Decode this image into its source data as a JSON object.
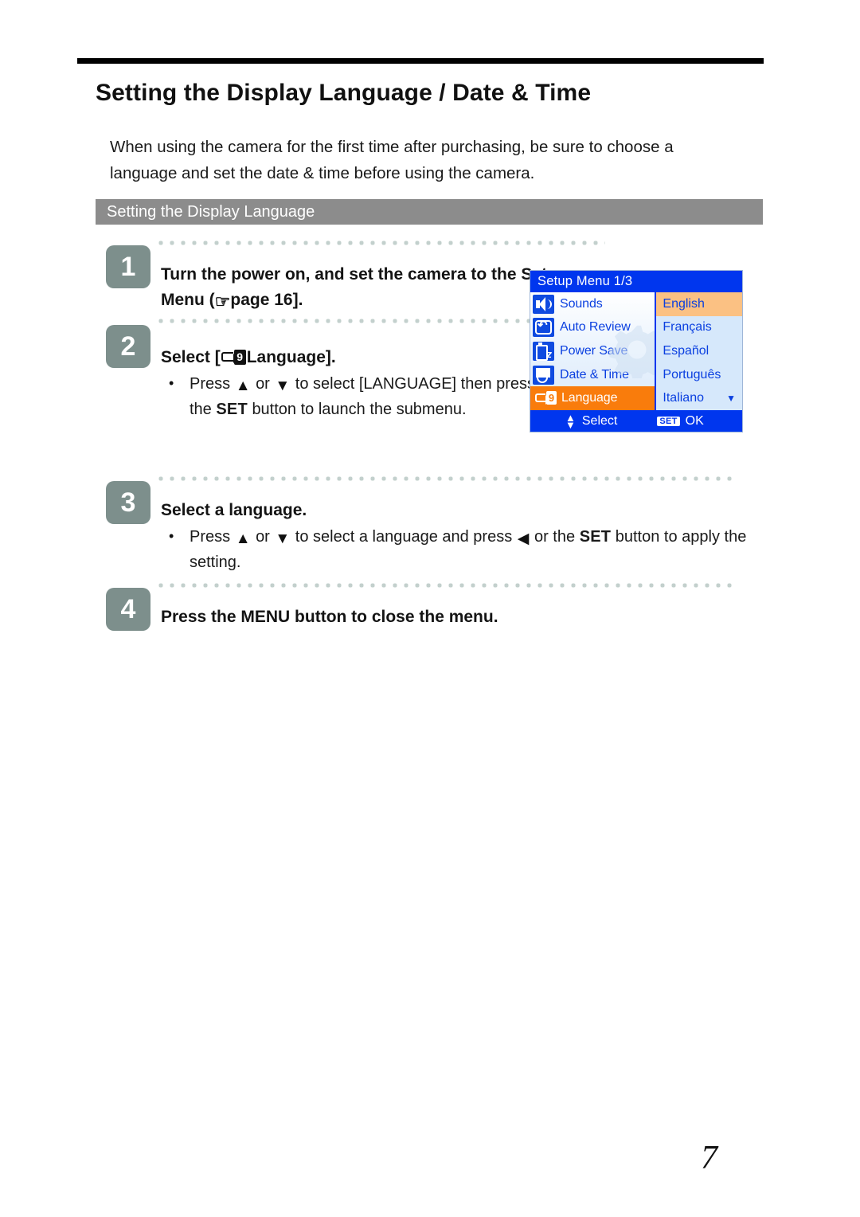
{
  "document": {
    "title": "Setting the Display Language / Date & Time",
    "intro": "When using the camera for the first time after purchasing, be sure to choose a language and set the date & time before using the camera.",
    "section_heading": "Setting the Display Language",
    "page_number": "7"
  },
  "steps": [
    {
      "number": "1",
      "title_a": "Turn the power on, and set the camera to the Setup Menu (",
      "title_b": "page 16]."
    },
    {
      "number": "2",
      "title_a": "Select [",
      "title_b": "Language].",
      "bullet_a": "Press",
      "bullet_or": "or",
      "bullet_b": "to select [LANGUAGE] then press",
      "bullet_c": "or the",
      "bullet_set": "SET",
      "bullet_d": "button to launch the submenu."
    },
    {
      "number": "3",
      "title": "Select a language.",
      "bullet_a": "Press",
      "bullet_or": "or",
      "bullet_b": "to select a language and press",
      "bullet_c": "or the",
      "bullet_set": "SET",
      "bullet_d": "button to apply the setting."
    },
    {
      "number": "4",
      "title": "Press the MENU button to close the menu."
    }
  ],
  "lcd": {
    "title": "Setup Menu 1/3",
    "menu_items": [
      {
        "icon": "speaker-icon",
        "label": "Sounds",
        "selected": false
      },
      {
        "icon": "auto-review-icon",
        "label": "Auto Review",
        "selected": false
      },
      {
        "icon": "battery-sleep-icon",
        "label": "Power Save",
        "selected": false
      },
      {
        "icon": "calendar-clock-icon",
        "label": "Date & Time",
        "selected": false
      },
      {
        "icon": "language-tag-icon",
        "label": "Language",
        "selected": true
      }
    ],
    "languages": [
      {
        "label": "English",
        "selected": true,
        "caret": ""
      },
      {
        "label": "Français",
        "selected": false,
        "caret": ""
      },
      {
        "label": "Español",
        "selected": false,
        "caret": ""
      },
      {
        "label": "Português",
        "selected": false,
        "caret": ""
      },
      {
        "label": "Italiano",
        "selected": false,
        "caret": "▼"
      }
    ],
    "footer": {
      "select_label": "Select",
      "set_badge": "SET",
      "ok_label": "OK"
    },
    "lang_icon_letter": "9"
  },
  "colors": {
    "lcd_blue": "#0036ee",
    "lcd_orange": "#f97c0c",
    "lcd_orange_light": "#fbc183",
    "lcd_panel_light": "#d6e8fb",
    "badge_gray": "#7d8f8c",
    "section_bar_gray": "#8c8c8c"
  }
}
